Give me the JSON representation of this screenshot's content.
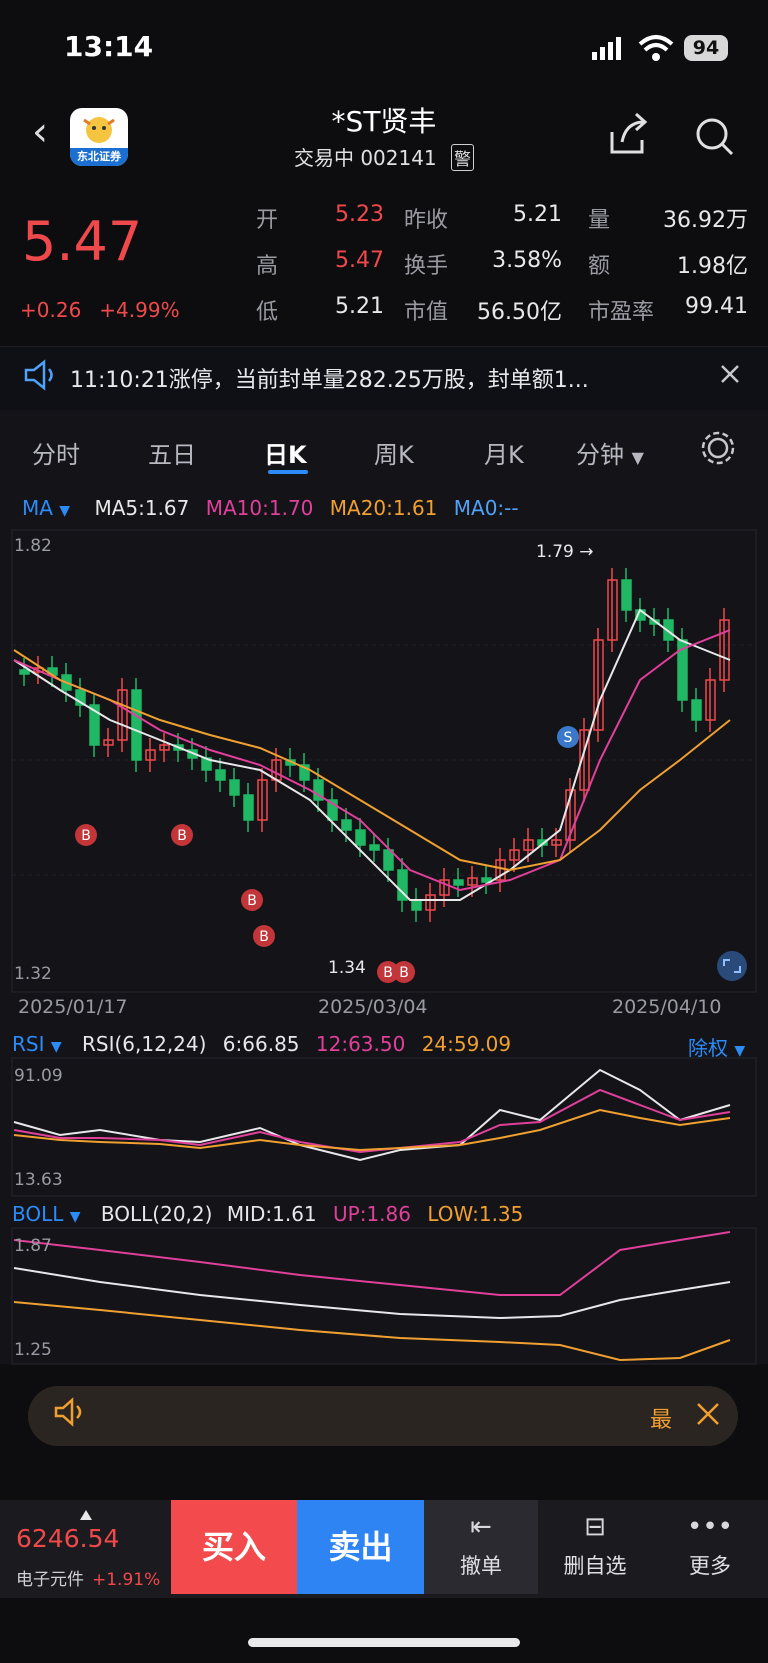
{
  "status_bar": {
    "time": "13:14",
    "battery": "94"
  },
  "header": {
    "logo_text": "东北证券",
    "title": "*ST贤丰",
    "status": "交易中",
    "code": "002141",
    "warn_badge": "警"
  },
  "quote": {
    "price": "5.47",
    "change": "+0.26",
    "change_pct": "+4.99%",
    "fields": [
      {
        "label": "开",
        "value": "5.23"
      },
      {
        "label": "昨收",
        "value": "5.21"
      },
      {
        "label": "量",
        "value": "36.92万"
      },
      {
        "label": "高",
        "value": "5.47"
      },
      {
        "label": "换手",
        "value": "3.58%"
      },
      {
        "label": "额",
        "value": "1.98亿"
      },
      {
        "label": "低",
        "value": "5.21"
      },
      {
        "label": "市值",
        "value": "56.50亿"
      },
      {
        "label": "市盈率",
        "value": "99.41"
      }
    ]
  },
  "banner": {
    "text": "11:10:21涨停，当前封单量282.25万股，封单额1..."
  },
  "tabs": [
    "分时",
    "五日",
    "日K",
    "周K",
    "月K",
    "分钟"
  ],
  "active_tab": "日K",
  "ma_legend": {
    "name": "MA",
    "ma5": "MA5:1.67",
    "ma10": "MA10:1.70",
    "ma20": "MA20:1.61",
    "ma0": "MA0:--"
  },
  "kline": {
    "y_top": "1.82",
    "y_bottom": "1.32",
    "high_label": "1.79",
    "low_label": "1.34",
    "dates": [
      "2025/01/17",
      "2025/03/04",
      "2025/04/10"
    ],
    "signal_b": "B",
    "signal_s": "S"
  },
  "rsi_legend": {
    "name": "RSI",
    "params": "RSI(6,12,24)",
    "r6": "6:66.85",
    "r12": "12:63.50",
    "r24": "24:59.09",
    "adjust": "除权"
  },
  "rsi_axis": {
    "top": "91.09",
    "bottom": "13.63"
  },
  "boll_legend": {
    "name": "BOLL",
    "params": "BOLL(20,2)",
    "mid": "MID:1.61",
    "up": "UP:1.86",
    "low": "LOW:1.35"
  },
  "boll_axis": {
    "top": "1.87",
    "bottom": "1.25"
  },
  "notice": {
    "text": "最"
  },
  "bottom_bar": {
    "index_value": "6246.54",
    "index_name": "电子元件",
    "index_change": "+1.91%",
    "buy": "买入",
    "sell": "卖出",
    "cancel": "撤单",
    "remove_watch": "删自选",
    "more": "更多"
  },
  "colors": {
    "up": "#f0494c",
    "down": "#20b865",
    "ma5": "#e8e8ea",
    "ma10": "#e0409a",
    "ma20": "#f0a030",
    "accent": "#2b8cf7"
  }
}
